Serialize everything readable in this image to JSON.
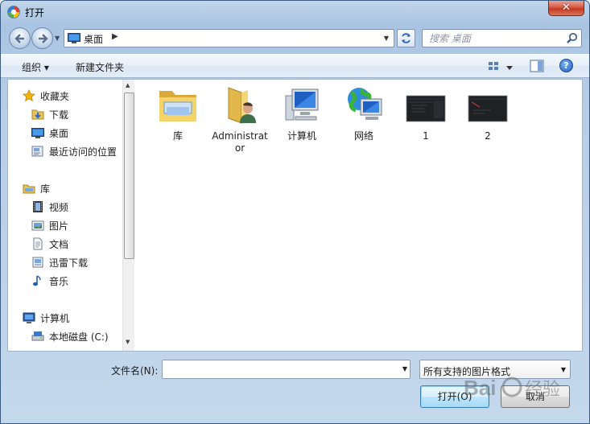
{
  "window": {
    "title": "打开",
    "close_glyph": "✕"
  },
  "address_bar": {
    "location": "桌面",
    "separator": "▶"
  },
  "search": {
    "placeholder": "搜索 桌面"
  },
  "toolbar": {
    "organize": "组织 ▾",
    "new_folder": "新建文件夹",
    "help": "?"
  },
  "nav": {
    "favorites": {
      "header": "收藏夹",
      "items": [
        "下载",
        "桌面",
        "最近访问的位置"
      ]
    },
    "libraries": {
      "header": "库",
      "items": [
        "视频",
        "图片",
        "文档",
        "迅雷下载",
        "音乐"
      ]
    },
    "computer": {
      "header": "计算机",
      "items": [
        "本地磁盘 (C:)"
      ]
    }
  },
  "files": [
    {
      "label": "库",
      "icon": "library-folder-icon"
    },
    {
      "label": "Administrator",
      "icon": "user-folder-icon"
    },
    {
      "label": "计算机",
      "icon": "computer-icon"
    },
    {
      "label": "网络",
      "icon": "network-icon"
    },
    {
      "label": "1",
      "icon": "image-thumbnail"
    },
    {
      "label": "2",
      "icon": "image-thumbnail"
    }
  ],
  "footer": {
    "filename_label": "文件名(N):",
    "filename_value": "",
    "filter_value": "所有支持的图片格式",
    "open_label": "打开(O)",
    "cancel_label": "取消"
  },
  "colors": {
    "accent": "#3c7fb1",
    "frame": "#b7cde6"
  }
}
